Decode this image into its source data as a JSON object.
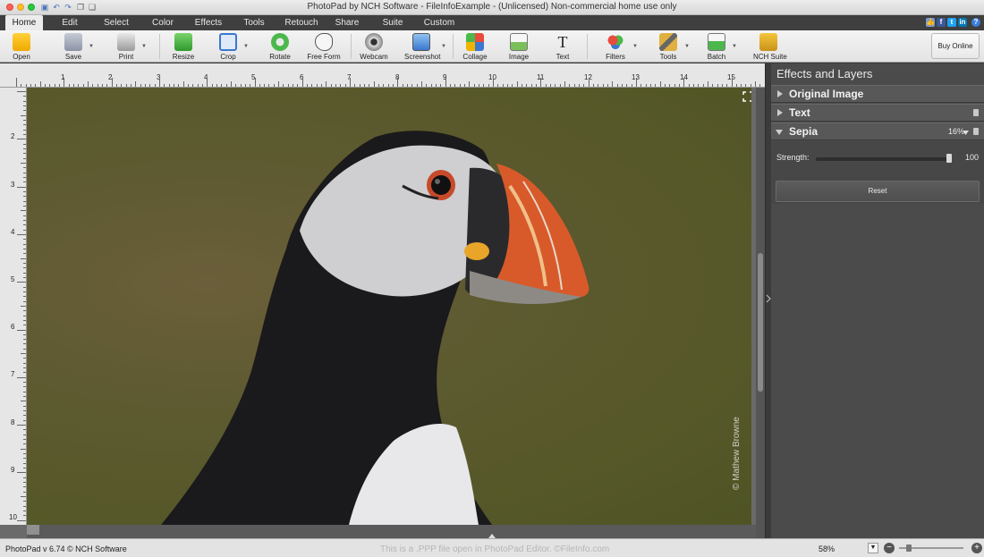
{
  "window": {
    "title": "PhotoPad by NCH Software - FileInfoExample - (Unlicensed) Non-commercial home use only"
  },
  "menu": {
    "tabs": [
      "Home",
      "Edit",
      "Select",
      "Color",
      "Effects",
      "Tools",
      "Retouch",
      "Share",
      "Suite",
      "Custom"
    ],
    "active": "Home"
  },
  "toolbar": {
    "open": "Open",
    "save": "Save",
    "print": "Print",
    "resize": "Resize",
    "crop": "Crop",
    "rotate": "Rotate",
    "free_form": "Free Form",
    "webcam": "Webcam",
    "screenshot": "Screenshot",
    "collage": "Collage",
    "image": "Image",
    "text": "Text",
    "filters": "Filters",
    "tools": "Tools",
    "batch": "Batch",
    "nch_suite": "NCH Suite",
    "buy_online": "Buy Online"
  },
  "rulers": {
    "top": [
      "1",
      "2",
      "3",
      "4",
      "5",
      "6",
      "7",
      "8",
      "9",
      "10",
      "11",
      "12",
      "13",
      "14",
      "15"
    ],
    "left": [
      "2",
      "3",
      "4",
      "5",
      "6",
      "7",
      "8",
      "9",
      "10"
    ]
  },
  "image": {
    "watermark": "© Mathew Browne",
    "background_color": "#575a2b"
  },
  "panel": {
    "title": "Effects and Layers",
    "layers": [
      {
        "name": "Original Image",
        "expanded": false
      },
      {
        "name": "Text",
        "expanded": false
      },
      {
        "name": "Sepia",
        "expanded": true,
        "opacity": "16%"
      }
    ],
    "strength_label": "Strength:",
    "strength_value": "100",
    "strength_level": 1.0,
    "reset": "Reset"
  },
  "status": {
    "version": "PhotoPad v 6.74 © NCH Software",
    "watermark_text": "This is a .PPP file open in PhotoPad Editor. ©FileInfo.com",
    "zoom": "58%",
    "zoom_level": 0.1
  },
  "colors": {
    "accent_blue": "#3b7dd8",
    "panel_bg": "#4b4b4b"
  }
}
